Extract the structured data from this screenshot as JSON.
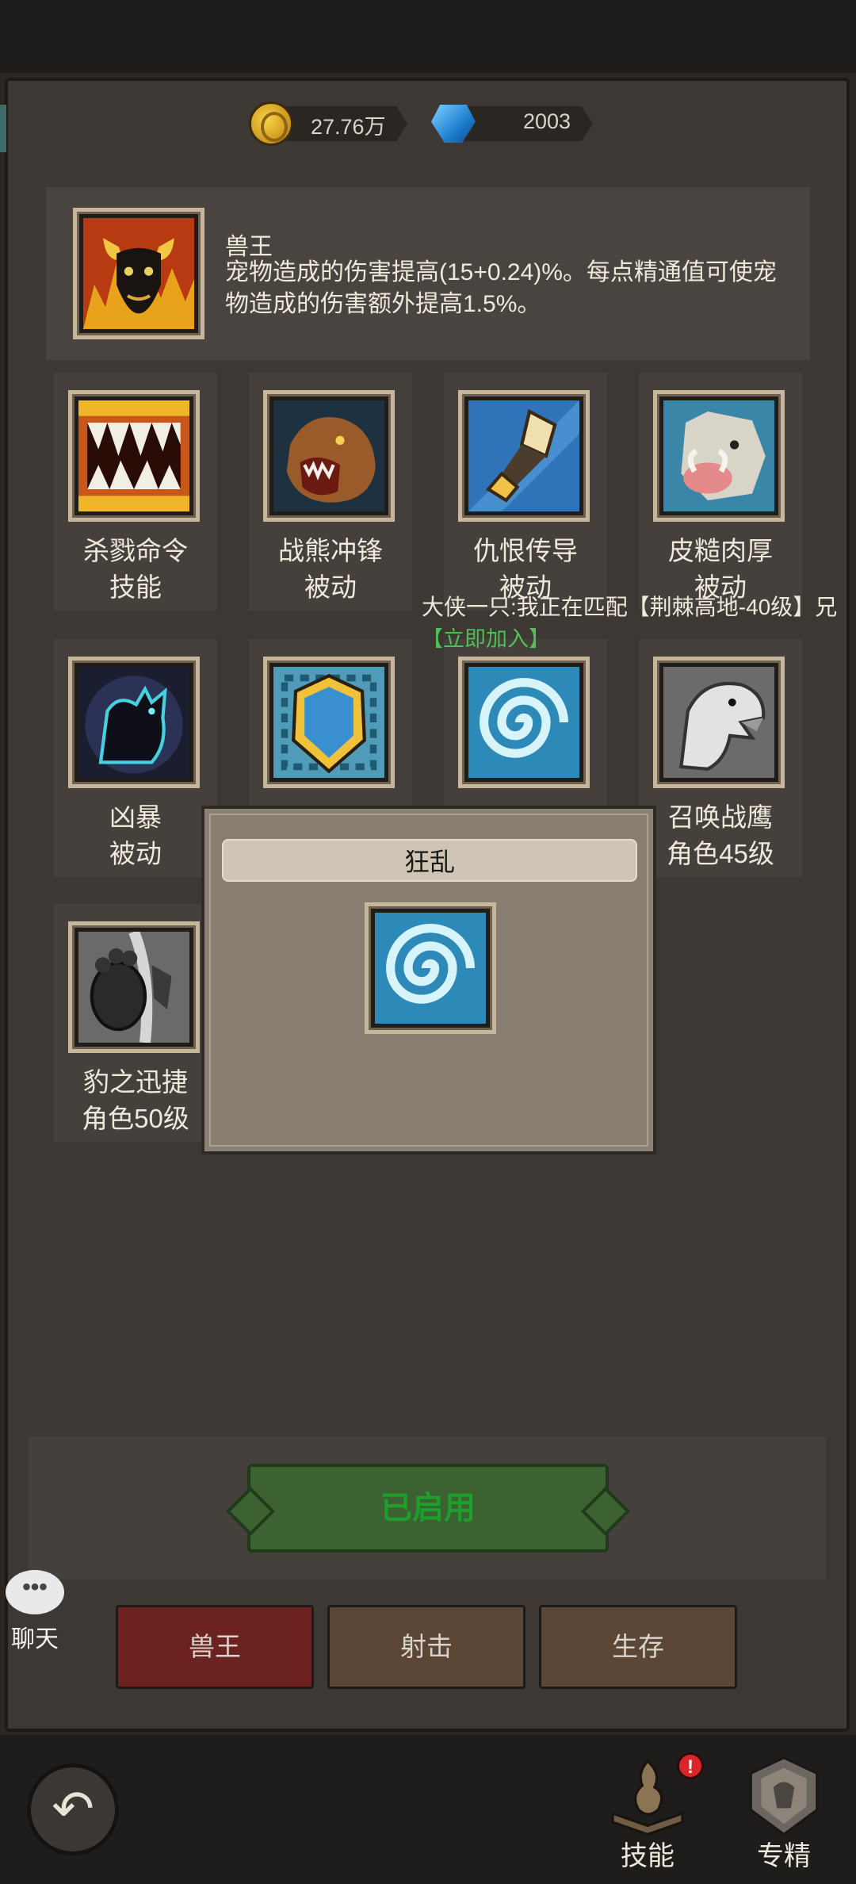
{
  "currency": {
    "gold": {
      "icon": "gold-coin-icon",
      "value": "27.76万"
    },
    "gems": {
      "icon": "blue-gem-icon",
      "value": "2003"
    }
  },
  "info": {
    "icon": "bull-head-icon",
    "title": "兽王",
    "description": "宠物造成的伤害提高(15+0.24)%。每点精通值可使宠物造成的伤害额外提高1.5%。"
  },
  "skills": [
    {
      "name": "杀戮命令",
      "sub": "技能",
      "icon": "fangs-icon"
    },
    {
      "name": "战熊冲锋",
      "sub": "被动",
      "icon": "roaring-bear-icon"
    },
    {
      "name": "仇恨传导",
      "sub": "被动",
      "icon": "arrowhead-icon"
    },
    {
      "name": "皮糙肉厚",
      "sub": "被动",
      "icon": "boar-icon"
    },
    {
      "name": "凶暴",
      "sub": "被动",
      "icon": "feral-cat-icon"
    },
    {
      "name": "",
      "sub": "",
      "icon": "shield-icon"
    },
    {
      "name": "",
      "sub": "",
      "icon": "blue-swirl-icon"
    },
    {
      "name": "召唤战鹰",
      "sub": "角色45级",
      "icon": "eagle-icon"
    },
    {
      "name": "豹之迅捷",
      "sub": "角色50级",
      "icon": "paw-icon"
    }
  ],
  "broadcast": {
    "message": "大侠一只:我正在匹配【荆棘高地-40级】兄",
    "join": "【立即加入】"
  },
  "popup": {
    "title": "狂乱",
    "icon": "blue-swirl-icon"
  },
  "enable_button": "已启用",
  "tabs": [
    {
      "label": "兽王",
      "active": true,
      "color": "#6b2221"
    },
    {
      "label": "射击",
      "active": false,
      "color": "#5c4737"
    },
    {
      "label": "生存",
      "active": false,
      "color": "#5c4737"
    }
  ],
  "chat": {
    "icon": "chat-bubble-icon",
    "label": "聊天",
    "bubble": "•••"
  },
  "bottom_nav": [
    {
      "label": "技能",
      "icon": "spellbook-icon",
      "badge": "!"
    },
    {
      "label": "专精",
      "icon": "specialization-crest-icon"
    }
  ],
  "back_icon": "back-arrow-icon",
  "colors": {
    "accent_green": "#1e9e2a",
    "panel": "#3d3833",
    "tile": "#45403b",
    "active_tab": "#6b2221"
  }
}
